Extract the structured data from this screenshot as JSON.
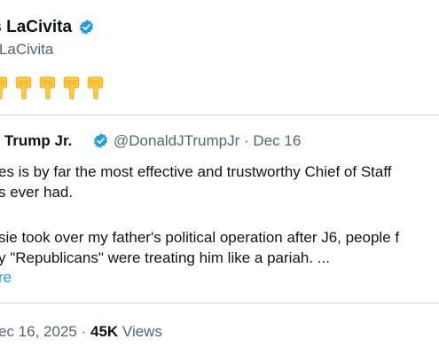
{
  "tweet": {
    "author_name": "is LaCivita",
    "author_handle": "risLaCivita",
    "verified_icon": "verified-badge-icon",
    "emoji_count": 5,
    "emoji_icon": "backhand-index-pointing-down-icon"
  },
  "quote": {
    "author_name": "ld Trump Jr.",
    "author_handle": "@DonaldJTrumpJr",
    "separator": "·",
    "date": "Dec 16",
    "line1": "es is by far the most effective and trustworthy Chief of Staff",
    "line2": "s ever had.",
    "line3": "sie took over my father's political operation after J6, people f",
    "line4": "y \"Republicans\" were treating him like a pariah. ...",
    "show_more": "re"
  },
  "meta": {
    "date": "ec 16, 2025",
    "separator": "·",
    "views_count": "45K",
    "views_label": "Views"
  },
  "colors": {
    "text": "#0f1419",
    "secondary": "#536471",
    "link": "#1d9bf0",
    "verified": "#1d9bf0",
    "border": "#cfd9de",
    "emoji": "#ffc83d"
  }
}
